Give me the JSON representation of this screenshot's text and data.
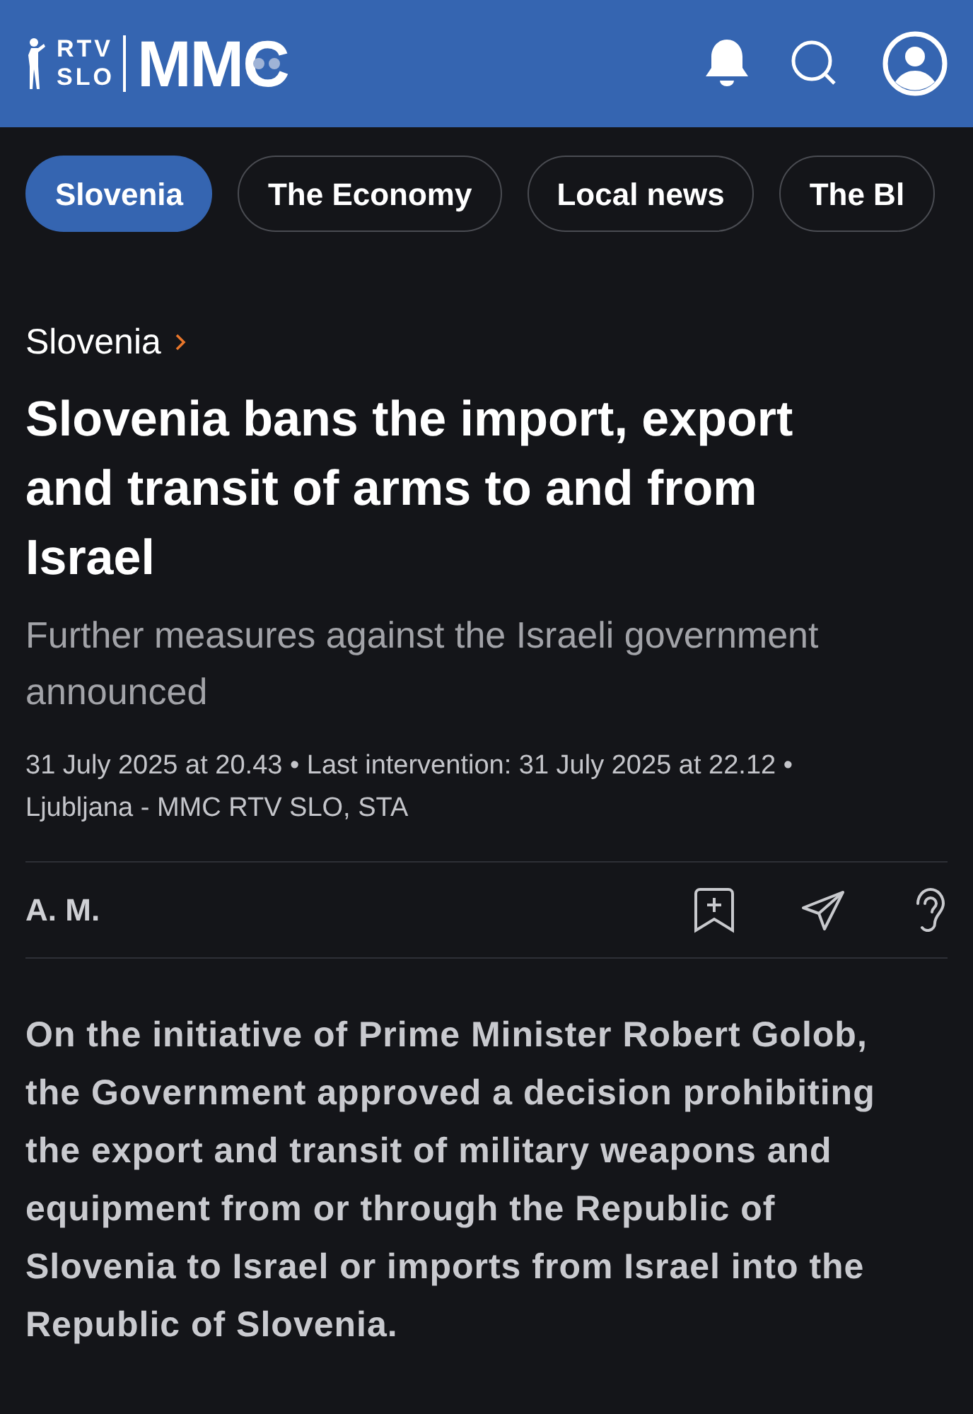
{
  "header": {
    "logo_top": "RTV",
    "logo_bottom": "SLO",
    "brand": "MMC"
  },
  "tabs": [
    {
      "label": "Slovenia",
      "selected": true
    },
    {
      "label": "The Economy",
      "selected": false
    },
    {
      "label": "Local news",
      "selected": false
    },
    {
      "label": "The Bl",
      "selected": false
    }
  ],
  "breadcrumb": "Slovenia",
  "headline": "Slovenia bans the import, export and transit of arms to and from Israel",
  "subtitle": "Further measures against the Israeli government announced",
  "meta": [
    "31 July 2025 at 20.43 • Last intervention: 31 July 2025 at 22.12 •",
    "Ljubljana - MMC RTV SLO, STA"
  ],
  "author": "A. M.",
  "lead": "On the initiative of Prime Minister Robert Golob, the Government approved a decision prohibiting the export and transit of military weapons and equipment from or through the Republic of Slovenia to Israel or imports from Israel into the Republic of Slovenia."
}
